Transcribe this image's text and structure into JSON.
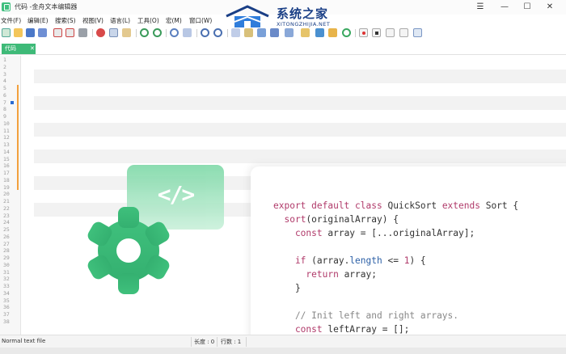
{
  "window": {
    "title": "代码 -金舟文本编辑器",
    "minimize_glyph": "☰",
    "restore_glyph": "—",
    "maximize_glyph": "☐",
    "close_glyph": "✕"
  },
  "logo": {
    "name_cn": "系统之家",
    "name_en": "XITONGZHIJIA.NET"
  },
  "menu": [
    {
      "label": "文件(F)"
    },
    {
      "label": "编辑(E)"
    },
    {
      "label": "搜索(S)"
    },
    {
      "label": "视图(V)"
    },
    {
      "label": "语言(L)"
    },
    {
      "label": "工具(O)"
    },
    {
      "label": "宏(M)"
    },
    {
      "label": "窗口(W)"
    }
  ],
  "toolbar_icons": [
    "new-file-icon",
    "open-file-icon",
    "save-icon",
    "save-all-icon",
    "close-file-icon",
    "close-all-icon",
    "print-icon",
    "cut-icon",
    "copy-icon",
    "paste-icon",
    "undo-icon",
    "redo-icon",
    "find-icon",
    "replace-icon",
    "zoom-in-icon",
    "zoom-out-icon",
    "sync-v-icon",
    "sync-h-icon",
    "wrap-icon",
    "indent-icon",
    "doc-map-icon",
    "function-list-icon",
    "folder-icon",
    "eye-icon",
    "record-icon",
    "stop-icon",
    "play-icon",
    "play-multi-icon",
    "save-macro-icon"
  ],
  "tab": {
    "label": "代码",
    "close_glyph": "✕"
  },
  "line_numbers": [
    "1",
    "2",
    "3",
    "4",
    "5",
    "6",
    "7",
    "8",
    "9",
    "10",
    "11",
    "12",
    "13",
    "14",
    "15",
    "16",
    "17",
    "18",
    "19",
    "20",
    "21",
    "22",
    "23",
    "24",
    "25",
    "26",
    "27",
    "28",
    "29",
    "30",
    "31",
    "32",
    "33",
    "34",
    "35",
    "36",
    "37",
    "38"
  ],
  "status": {
    "file_type": "Normal text file",
    "length": "长度 : 0",
    "lines": "行数 : 1"
  },
  "badge": {
    "symbol": "</>"
  },
  "code_card": {
    "lines": [
      {
        "t": "export default class QuickSort extends Sort {"
      },
      {
        "t": "  sort(originalArray) {"
      },
      {
        "t": "    const array = [...originalArray];"
      },
      {
        "t": ""
      },
      {
        "t": "    if (array.length <= 1) {"
      },
      {
        "t": "      return array;"
      },
      {
        "t": "    }"
      },
      {
        "t": ""
      },
      {
        "t": "    // Init left and right arrays."
      },
      {
        "t": "    const leftArray = [];"
      }
    ]
  },
  "colors": {
    "accent_green": "#3eba78",
    "logo_blue": "#1a3f86",
    "keyword": "#b03a6a",
    "change_bar": "#f2a03d"
  }
}
